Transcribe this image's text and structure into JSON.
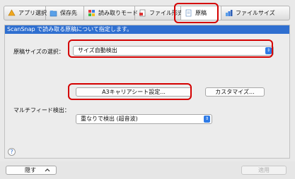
{
  "tabs": [
    {
      "label": "アプリ選択",
      "icon": "app-select-icon"
    },
    {
      "label": "保存先",
      "icon": "save-folder-icon"
    },
    {
      "label": "読み取りモード",
      "icon": "scan-mode-icon"
    },
    {
      "label": "ファイル形式",
      "icon": "file-format-icon"
    },
    {
      "label": "原稿",
      "icon": "document-icon"
    },
    {
      "label": "ファイルサイズ",
      "icon": "file-size-icon"
    }
  ],
  "active_tab": "原稿",
  "panel": {
    "header": "ScanSnap で読み取る原稿について指定します。",
    "paper_size_label": "原稿サイズの選択：",
    "paper_size_value": "サイズ自動検出",
    "a3_carrier_button": "A3キャリアシート設定...",
    "customize_button": "カスタマイズ...",
    "multifeed_label": "マルチフィード検出：",
    "multifeed_value": "重なりで検出 (超音波)"
  },
  "help": "?",
  "footer": {
    "hide_button": "隠す",
    "hide_button_icon": "chevron-up-icon",
    "apply_button": "適用"
  },
  "colors": {
    "accent": "#2f6fd0",
    "highlight": "#d40000"
  }
}
